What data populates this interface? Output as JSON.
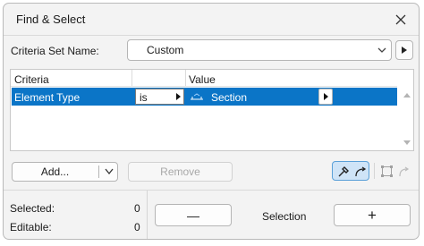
{
  "window": {
    "title": "Find & Select"
  },
  "criteria_set": {
    "label": "Criteria Set Name:",
    "value": "Custom"
  },
  "table": {
    "columns": [
      "Criteria",
      "Value"
    ],
    "rows": [
      {
        "criteria": "Element Type",
        "operator": "is",
        "value": "Section"
      }
    ]
  },
  "buttons": {
    "add": "Add...",
    "remove": "Remove"
  },
  "status": {
    "selected_label": "Selected:",
    "selected_value": "0",
    "editable_label": "Editable:",
    "editable_value": "0"
  },
  "selection": {
    "minus": "—",
    "label": "Selection",
    "plus": "+"
  },
  "colors": {
    "accent": "#0b75c7",
    "toggle_on": "#cfe4f7"
  }
}
